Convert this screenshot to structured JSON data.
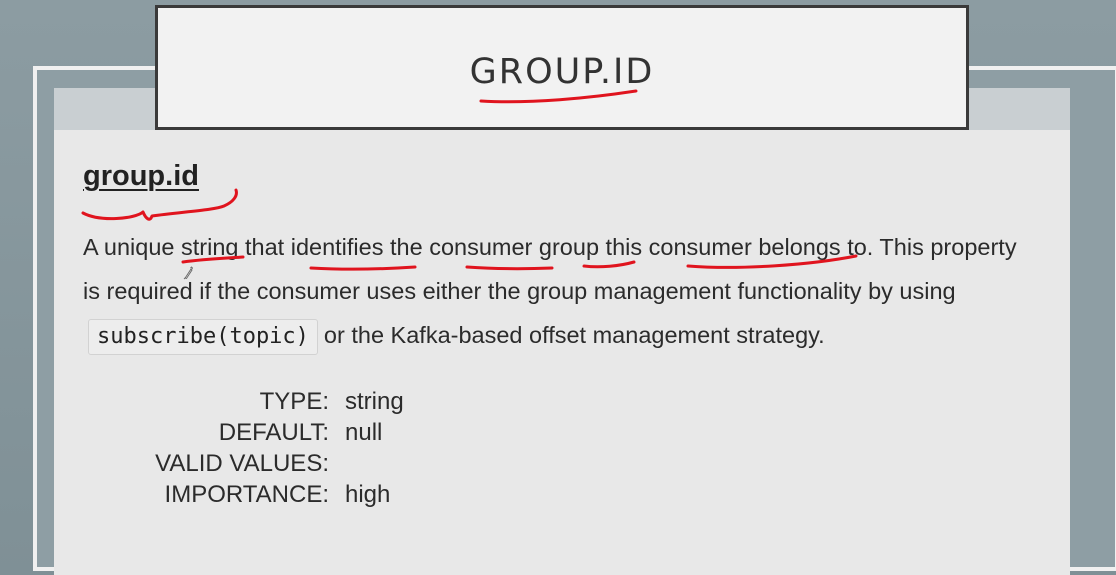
{
  "slide": {
    "title": "GROUP.ID"
  },
  "doc": {
    "property_name": "group.id",
    "description_line1": "A unique string that identifies the consumer group this consumer belongs to. This property",
    "description_line2": "is required if the consumer uses either the group management functionality by using",
    "code_snippet": "subscribe(topic)",
    "description_line3": "or the Kafka-based offset management strategy.",
    "meta": [
      {
        "key": "TYPE:",
        "value": "string"
      },
      {
        "key": "DEFAULT:",
        "value": "null"
      },
      {
        "key": "VALID VALUES:",
        "value": ""
      },
      {
        "key": "IMPORTANCE:",
        "value": "high"
      }
    ]
  },
  "colors": {
    "annotation_ink": "#e0141e",
    "background": "#8c9ca2",
    "panel": "#e8e8e8"
  },
  "icons": {
    "pointer": "pen-cursor-icon"
  }
}
